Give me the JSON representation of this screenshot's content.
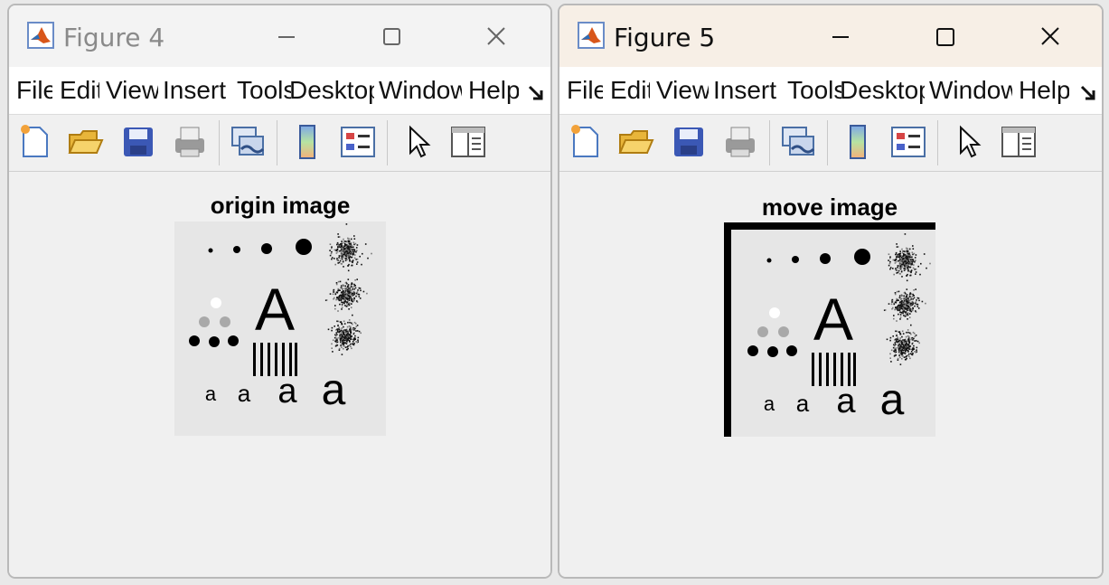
{
  "figure4": {
    "title": "Figure 4",
    "menus": [
      "File",
      "Edit",
      "View",
      "Insert",
      "Tools",
      "Desktop",
      "Window",
      "Help"
    ],
    "axes_title": "origin image",
    "image_letters": {
      "big": "A",
      "small": "a"
    }
  },
  "figure5": {
    "title": "Figure 5",
    "menus": [
      "File",
      "Edit",
      "View",
      "Insert",
      "Tools",
      "Desktop",
      "Window",
      "Help"
    ],
    "axes_title": "move image",
    "image_letters": {
      "big": "A",
      "small": "a"
    }
  },
  "toolbar_icons": [
    "new-figure-icon",
    "open-file-icon",
    "save-icon",
    "print-icon",
    "link-plot-icon",
    "colorbar-icon",
    "legend-icon",
    "pointer-icon",
    "property-inspector-icon"
  ],
  "colors": {
    "window_bg": "#f0f0f0",
    "image_bg": "#e6e6e6",
    "border_black": "#000000"
  }
}
